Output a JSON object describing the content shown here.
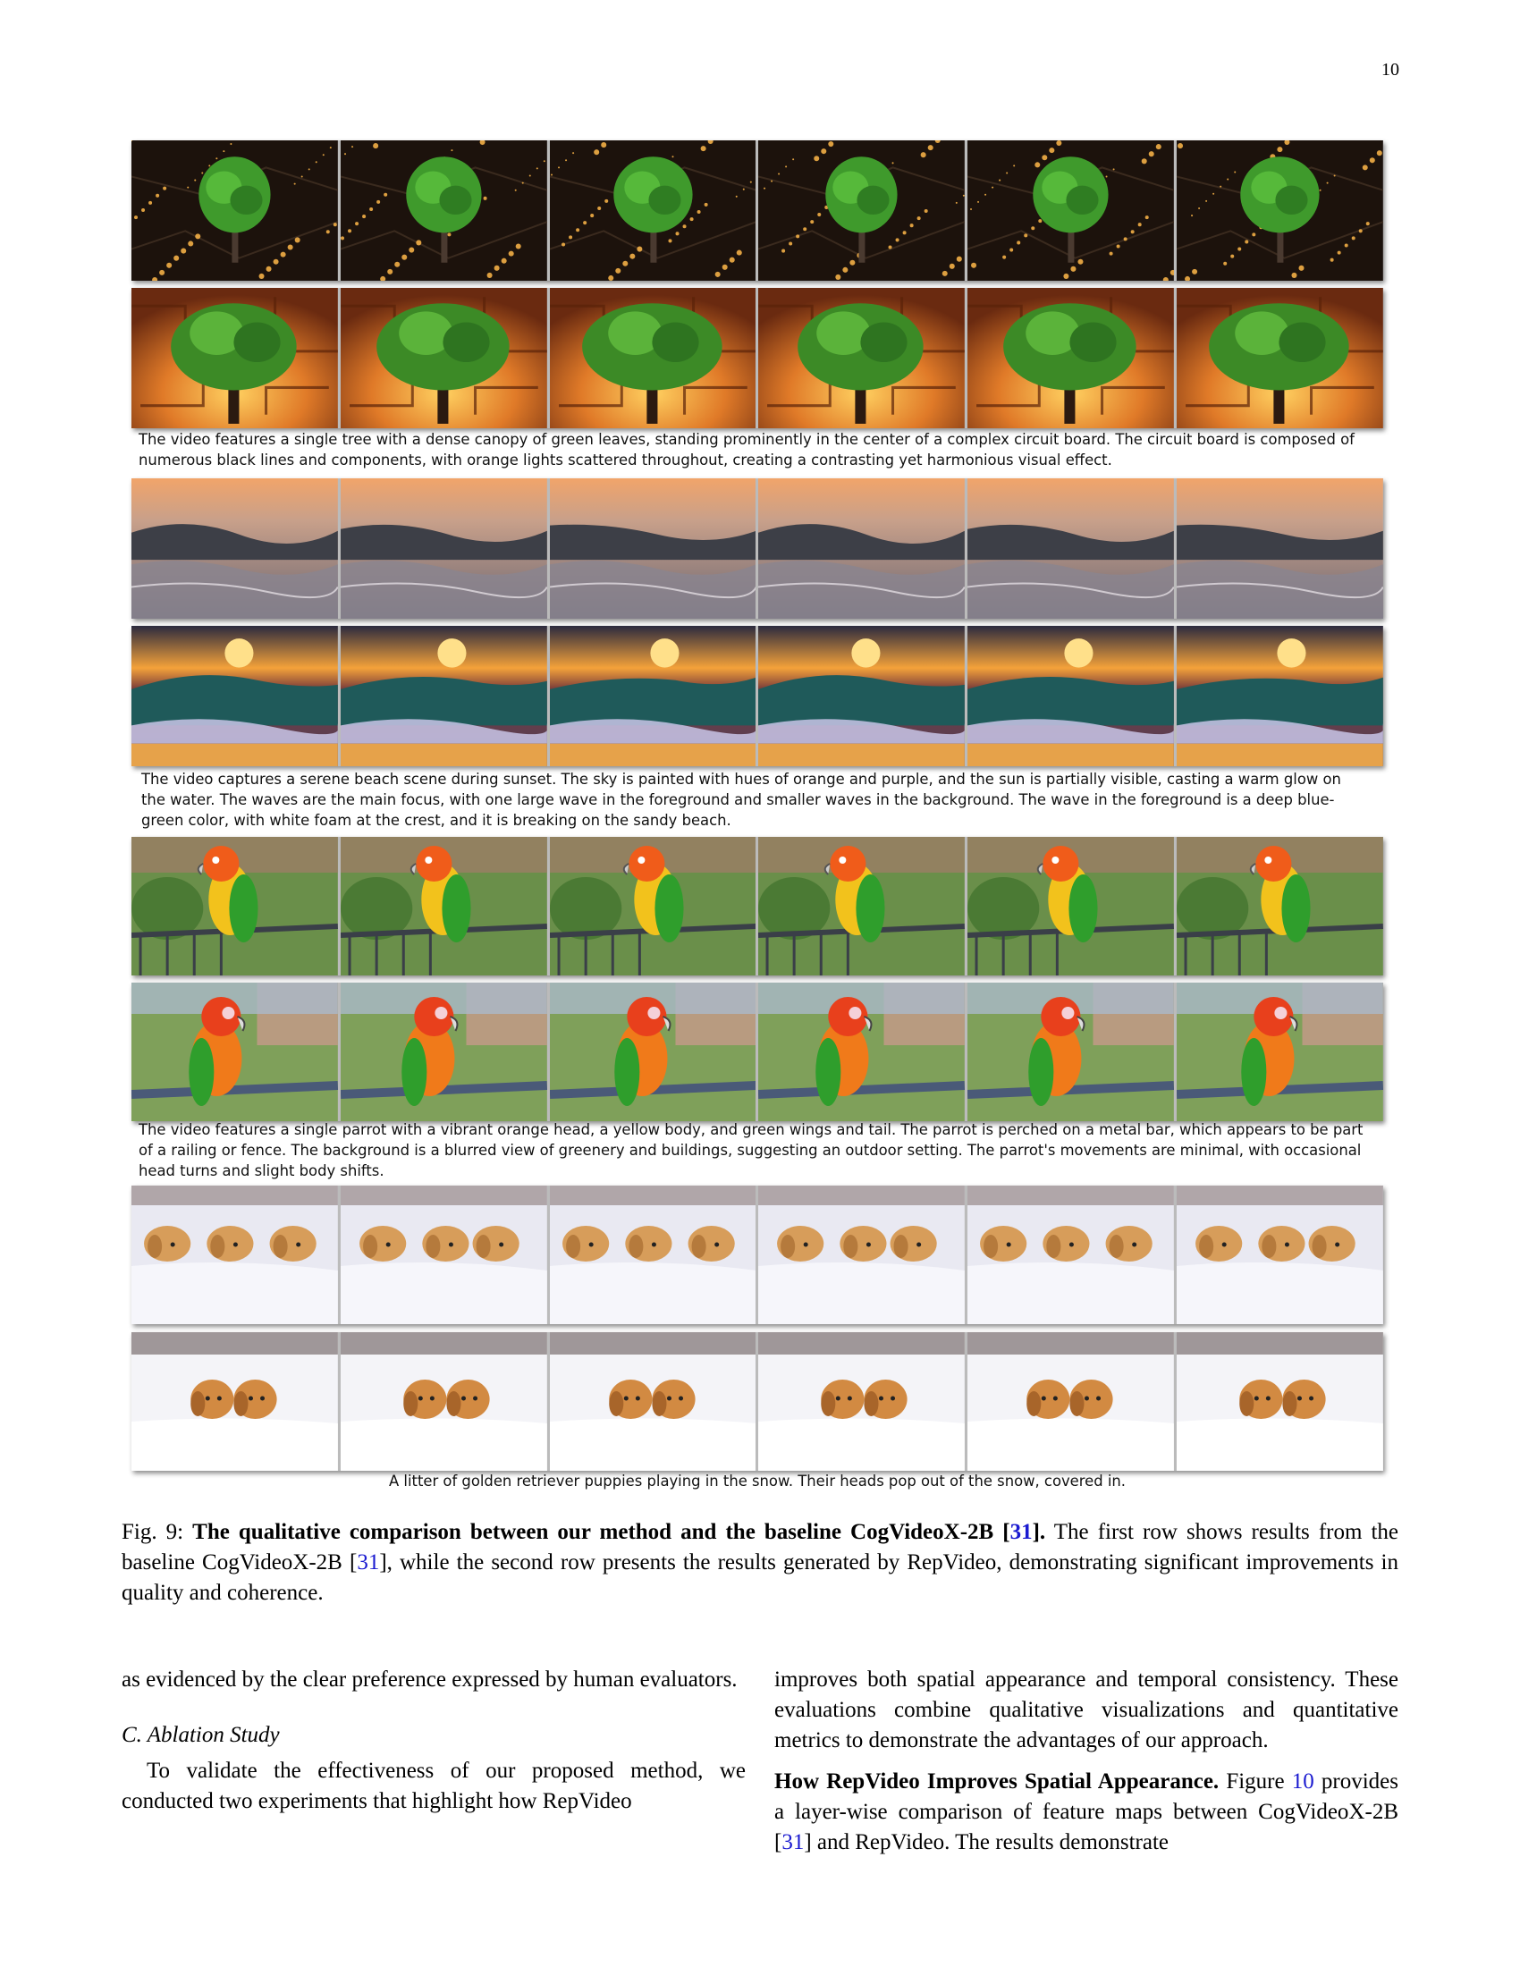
{
  "page": {
    "number": "10"
  },
  "figure": {
    "groups": [
      {
        "subject": "tree",
        "prompt": "The video features a single tree with a dense canopy of green leaves, standing prominently in the center of a complex circuit board. The circuit board is composed of numerous black lines and components, with orange lights scattered throughout, creating a contrasting yet harmonious visual effect."
      },
      {
        "subject": "wave",
        "prompt": "The video captures a serene beach scene during sunset. The sky is painted with hues of orange and purple, and the sun is partially visible, casting a warm glow on the water. The waves are the main focus, with one large wave in the foreground and smaller waves in the background. The wave in the foreground is a deep blue-green color, with white foam at the crest, and it is breaking on the sandy beach."
      },
      {
        "subject": "parrot",
        "prompt": "The video features a single parrot with a vibrant orange head, a yellow body, and green wings and tail. The parrot is perched on a metal bar, which appears to be part of a railing or fence. The background is a blurred view of greenery and buildings, suggesting an outdoor setting. The parrot's movements are minimal, with occasional head turns and slight body shifts."
      },
      {
        "subject": "puppies",
        "prompt": "A litter of golden retriever puppies playing in the snow. Their heads pop out of the snow, covered in."
      }
    ],
    "caption": {
      "label": "Fig. 9:",
      "bold_title_pre": "The qualitative comparison between our method and the baseline CogVideoX-2B [",
      "bold_title_cite": "31",
      "bold_title_post": "].",
      "text_1": " The first row shows results from the baseline CogVideoX-2B [",
      "cite": "31",
      "text_2": "], while the second row presents the results generated by RepVideo, demonstrating significant improvements in quality and coherence."
    }
  },
  "body": {
    "left_column": {
      "continuation": "as evidenced by the clear preference expressed by human evaluators.",
      "section_heading": "C.  Ablation Study",
      "paragraph": "To validate the effectiveness of our proposed method, we conducted two experiments that highlight how RepVideo"
    },
    "right_column": {
      "paragraph_1": "improves both spatial appearance and temporal consistency. These evaluations combine qualitative visualizations and quantitative metrics to demonstrate the advantages of our approach.",
      "bold_lead": "How RepVideo Improves Spatial Appearance.",
      "text_a": " Figure ",
      "fig_ref": "10",
      "text_b": " provides a layer-wise comparison of feature maps between CogVideoX-2B [",
      "cite": "31",
      "text_c": "] and RepVideo. The results demonstrate"
    }
  }
}
